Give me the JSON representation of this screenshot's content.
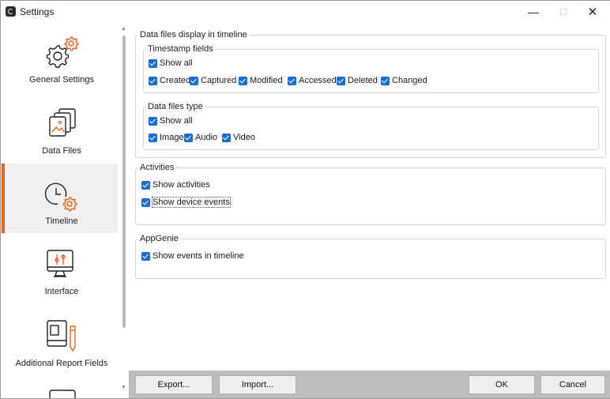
{
  "window": {
    "title": "Settings"
  },
  "titlebar": {
    "minimize": "—",
    "maximize": "☐",
    "close": "✕"
  },
  "sidebar": {
    "items": [
      {
        "label": "General Settings",
        "icon": "gear-icon"
      },
      {
        "label": "Data Files",
        "icon": "data-files-icon"
      },
      {
        "label": "Timeline",
        "icon": "timeline-clock-icon",
        "active": true
      },
      {
        "label": "Interface",
        "icon": "monitor-sliders-icon"
      },
      {
        "label": "Additional Report Fields",
        "icon": "notebook-pencil-icon"
      }
    ]
  },
  "main": {
    "data_files_group": {
      "title": "Data files display in timeline",
      "timestamp_fields": {
        "title": "Timestamp fields",
        "show_all": "Show all",
        "options": [
          "Created",
          "Captured",
          "Modified",
          "Accessed",
          "Deleted",
          "Changed"
        ]
      },
      "data_files_type": {
        "title": "Data files type",
        "show_all": "Show all",
        "options": [
          "Image",
          "Audio",
          "Video"
        ]
      }
    },
    "activities_group": {
      "title": "Activities",
      "show_activities": "Show activities",
      "show_device_events": "Show device events"
    },
    "appgenie_group": {
      "title": "AppGenie",
      "show_events": "Show events in timeline"
    }
  },
  "footer": {
    "export": "Export...",
    "import": "Import...",
    "ok": "OK",
    "cancel": "Cancel"
  },
  "colors": {
    "accent": "#e8661e",
    "checkbox": "#1a6ed8",
    "footer_bg": "#bdbdbd"
  }
}
